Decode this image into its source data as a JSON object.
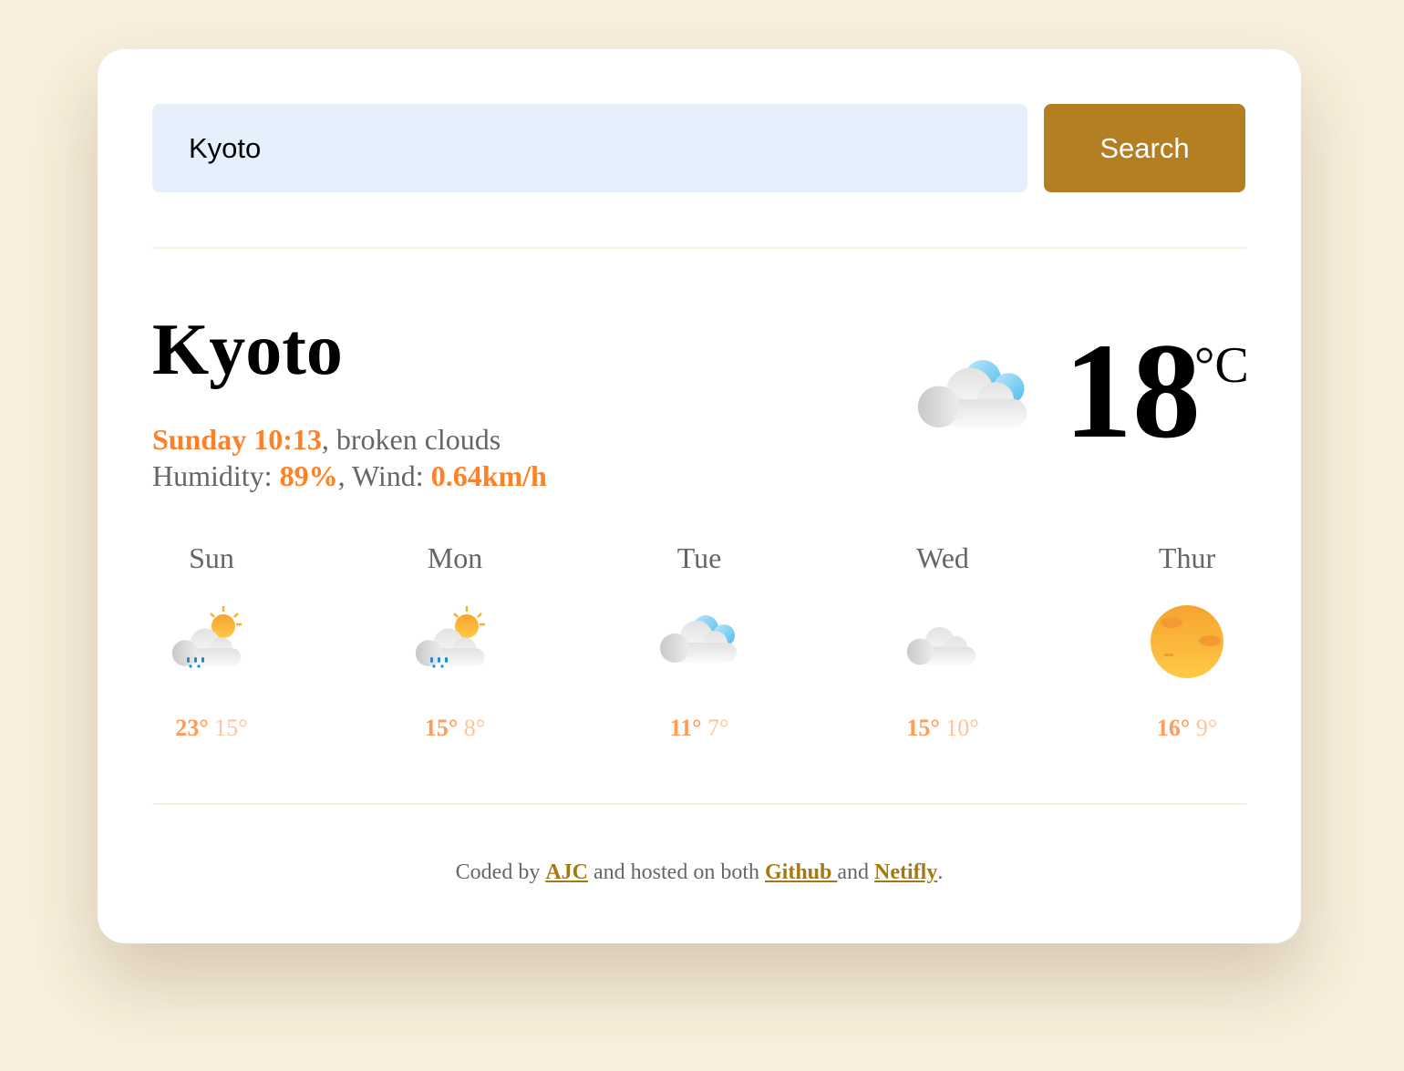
{
  "search": {
    "value": "Kyoto",
    "button_label": "Search"
  },
  "current": {
    "city": "Kyoto",
    "day_time": "Sunday 10:13",
    "description": ", broken clouds",
    "humidity_label": "Humidity: ",
    "humidity": "89%",
    "wind_label": ", Wind: ",
    "wind": "0.64km/h",
    "temperature": "18",
    "unit": "°C",
    "icon": "broken-clouds-icon"
  },
  "forecast": [
    {
      "day": "Sun",
      "icon": "rain-sun-icon",
      "max": "23°",
      "min": "15°"
    },
    {
      "day": "Mon",
      "icon": "rain-sun-icon",
      "max": "15°",
      "min": "8°"
    },
    {
      "day": "Tue",
      "icon": "broken-clouds-icon",
      "max": "11°",
      "min": "7°"
    },
    {
      "day": "Wed",
      "icon": "cloud-icon",
      "max": "15°",
      "min": "10°"
    },
    {
      "day": "Thur",
      "icon": "haze-sun-icon",
      "max": "16°",
      "min": "9°"
    }
  ],
  "footer": {
    "t1": "Coded by ",
    "ajc": "AJC",
    "t2": " and hosted on both ",
    "github": "Github ",
    "t3": "and ",
    "netlify": "Netifly",
    "t4": "."
  },
  "colors": {
    "accent": "#ff8126",
    "button": "#b47f23",
    "input_bg": "#e6f0fc",
    "background": "#f8efdc"
  }
}
